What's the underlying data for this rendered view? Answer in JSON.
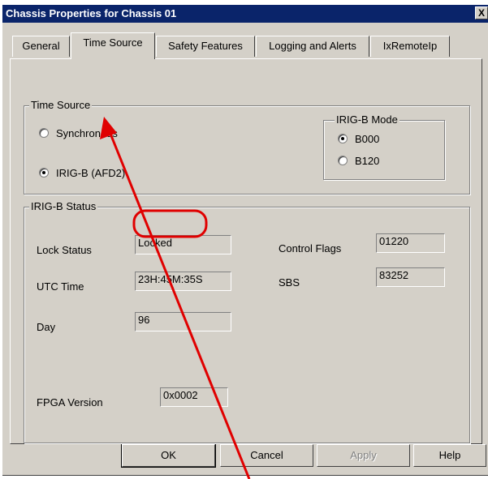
{
  "window": {
    "title": "Chassis Properties for Chassis 01",
    "close_glyph": "X"
  },
  "tabs": [
    {
      "label": "General"
    },
    {
      "label": "Time Source"
    },
    {
      "label": "Safety Features"
    },
    {
      "label": "Logging and Alerts"
    },
    {
      "label": "IxRemoteIp"
    }
  ],
  "time_source": {
    "group_label": "Time Source",
    "options": [
      {
        "label": "Synchronous",
        "checked": false
      },
      {
        "label": "IRIG-B (AFD2)",
        "checked": true
      }
    ],
    "irig_mode": {
      "group_label": "IRIG-B Mode",
      "options": [
        {
          "label": "B000",
          "checked": true
        },
        {
          "label": "B120",
          "checked": false
        }
      ]
    }
  },
  "irig_status": {
    "group_label": "IRIG-B Status",
    "lock_status": {
      "label": "Lock Status",
      "value": "Locked"
    },
    "utc_time": {
      "label": "UTC Time",
      "value": "23H:45M:35S"
    },
    "day": {
      "label": "Day",
      "value": "96"
    },
    "fpga_version": {
      "label": "FPGA Version",
      "value": "0x0002"
    },
    "control_flags": {
      "label": "Control Flags",
      "value": "01220"
    },
    "sbs": {
      "label": "SBS",
      "value": "83252"
    }
  },
  "buttons": {
    "ok": "OK",
    "cancel": "Cancel",
    "apply": "Apply",
    "help": "Help"
  },
  "annotations": {
    "highlight_color": "#e00000"
  }
}
